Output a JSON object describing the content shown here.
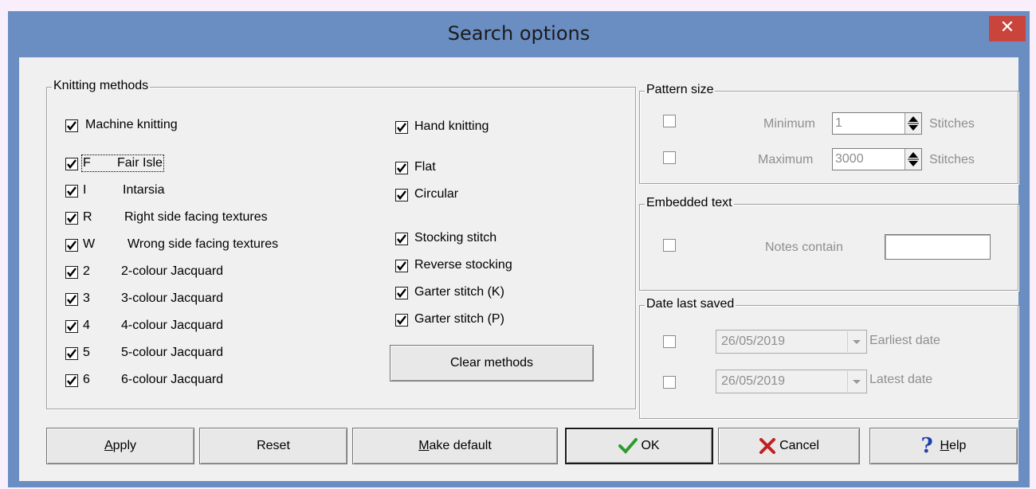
{
  "window": {
    "title": "Search options",
    "close_label": "✕"
  },
  "knitting": {
    "legend": "Knitting methods",
    "machine": {
      "label": "Machine knitting",
      "checked": true
    },
    "methods": [
      {
        "code": "F",
        "label": "Fair Isle",
        "checked": true
      },
      {
        "code": "I",
        "label": "Intarsia",
        "checked": true
      },
      {
        "code": "R",
        "label": "Right side facing textures",
        "checked": true
      },
      {
        "code": "W",
        "label": "Wrong side facing textures",
        "checked": true
      },
      {
        "code": "2",
        "label": "2-colour Jacquard",
        "checked": true
      },
      {
        "code": "3",
        "label": "3-colour Jacquard",
        "checked": true
      },
      {
        "code": "4",
        "label": "4-colour Jacquard",
        "checked": true
      },
      {
        "code": "5",
        "label": "5-colour Jacquard",
        "checked": true
      },
      {
        "code": "6",
        "label": "6-colour Jacquard",
        "checked": true
      }
    ],
    "hand": {
      "label": "Hand knitting",
      "checked": true
    },
    "flat": {
      "label": "Flat",
      "checked": true
    },
    "circular": {
      "label": "Circular",
      "checked": true
    },
    "stocking": {
      "label": "Stocking stitch",
      "checked": true
    },
    "reverse": {
      "label": "Reverse stocking",
      "checked": true
    },
    "garter_k": {
      "label": "Garter stitch (K)",
      "checked": true
    },
    "garter_p": {
      "label": "Garter stitch (P)",
      "checked": true
    },
    "clear_label": "Clear methods"
  },
  "pattern_size": {
    "legend": "Pattern size",
    "min_label": "Minimum",
    "min_value": "1",
    "min_unit": "Stitches",
    "max_label": "Maximum",
    "max_value": "3000",
    "max_unit": "Stitches"
  },
  "embedded": {
    "legend": "Embedded text",
    "notes_label": "Notes contain",
    "notes_value": ""
  },
  "date": {
    "legend": "Date last saved",
    "earliest_value": "26/05/2019",
    "earliest_label": "Earliest date",
    "latest_value": "26/05/2019",
    "latest_label": "Latest date"
  },
  "buttons": {
    "apply_u": "A",
    "apply_rest": "pply",
    "reset": "Reset",
    "make_u": "M",
    "make_rest": "ake default",
    "ok": "OK",
    "cancel": "Cancel",
    "help_u": "H",
    "help_rest": "elp"
  },
  "icons": {
    "check": "check-icon",
    "x": "x-icon",
    "help": "question-icon"
  },
  "colors": {
    "titlebar": "#6a8dc2",
    "close": "#c9443c",
    "ok_check": "#2f9a2f",
    "cancel_x": "#c22020",
    "help_q": "#1f3fb0"
  }
}
